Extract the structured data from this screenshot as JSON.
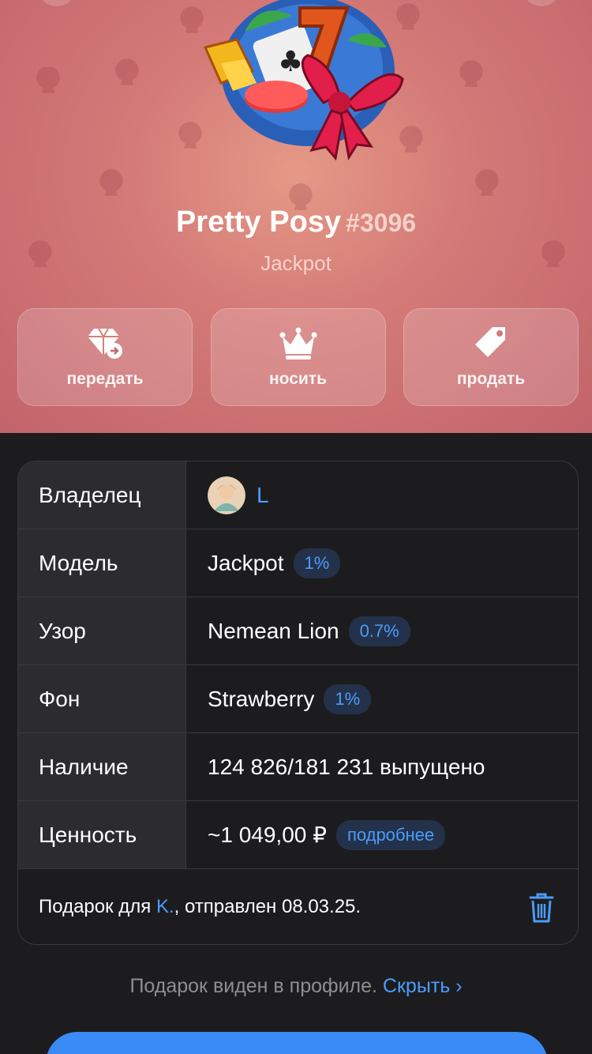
{
  "gift": {
    "name": "Pretty Posy",
    "number": "#3096",
    "model_subtitle": "Jackpot"
  },
  "actions": [
    {
      "label": "передать",
      "icon": "transfer-gift-icon"
    },
    {
      "label": "носить",
      "icon": "crown-icon"
    },
    {
      "label": "продать",
      "icon": "price-tag-icon"
    }
  ],
  "details": {
    "owner": {
      "key": "Владелец",
      "name": "L"
    },
    "model": {
      "key": "Модель",
      "value": "Jackpot",
      "badge": "1%"
    },
    "pattern": {
      "key": "Узор",
      "value": "Nemean Lion",
      "badge": "0.7%"
    },
    "backdrop": {
      "key": "Фон",
      "value": "Strawberry",
      "badge": "1%"
    },
    "availability": {
      "key": "Наличие",
      "value": "124 826/181 231 выпущено"
    },
    "value": {
      "key": "Ценность",
      "value": "~1 049,00 ₽",
      "badge": "подробнее"
    }
  },
  "footer": {
    "prefix": "Подарок для ",
    "recipient": "K.",
    "suffix": ", отправлен 08.03.25."
  },
  "visibility": {
    "text": "Подарок виден в профиле. ",
    "action": "Скрыть",
    "chevron": "›"
  },
  "colors": {
    "accent": "#4b9cff",
    "hero_background": "#d47a78",
    "card_background": "#1c1c1e",
    "key_cell_background": "#2c2c2e",
    "badge_background": "#23324a"
  }
}
